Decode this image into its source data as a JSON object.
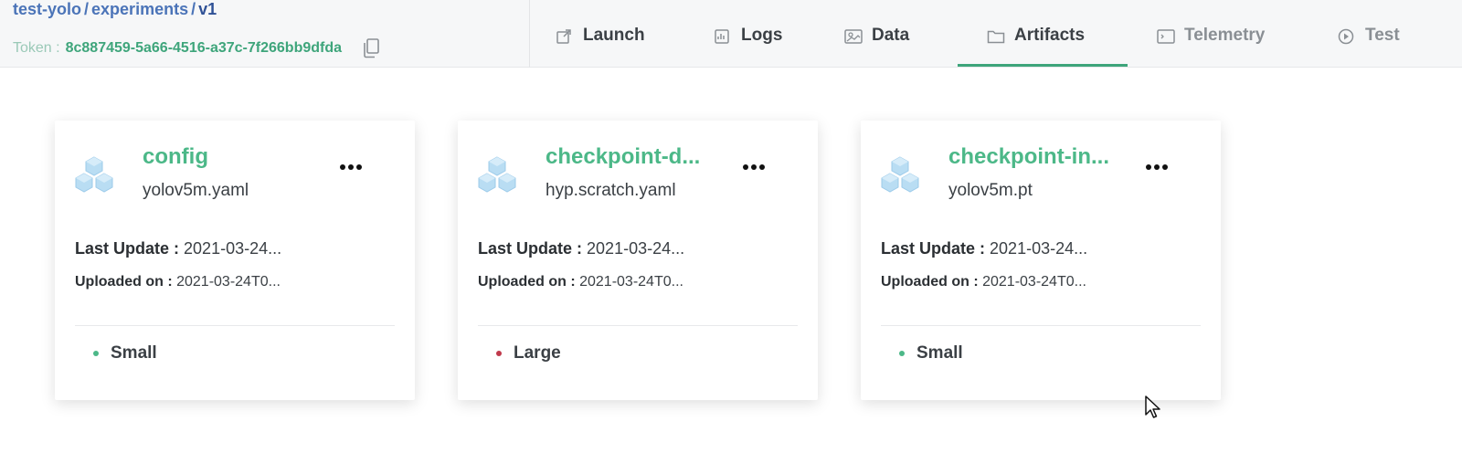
{
  "breadcrumb": {
    "project": "test-yolo",
    "section": "experiments",
    "current": "v1",
    "separator": "/"
  },
  "token": {
    "label": "Token :",
    "value": "8c887459-5a66-4516-a37c-7f266bb9dfda"
  },
  "tabs": [
    {
      "label": "Launch",
      "icon": "launch-icon",
      "state": "normal"
    },
    {
      "label": "Logs",
      "icon": "logs-icon",
      "state": "normal"
    },
    {
      "label": "Data",
      "icon": "data-icon",
      "state": "normal"
    },
    {
      "label": "Artifacts",
      "icon": "folder-icon",
      "state": "active"
    },
    {
      "label": "Telemetry",
      "icon": "terminal-icon",
      "state": "disabled"
    },
    {
      "label": "Test",
      "icon": "play-circle-icon",
      "state": "disabled"
    }
  ],
  "cards": [
    {
      "title": "config",
      "file": "yolov5m.yaml",
      "last_update_label": "Last Update :",
      "last_update": "2021-03-24...",
      "uploaded_label": "Uploaded on :",
      "uploaded": "2021-03-24T0...",
      "size": "Small",
      "size_color": "#4cb888"
    },
    {
      "title": "checkpoint-d...",
      "file": "hyp.scratch.yaml",
      "last_update_label": "Last Update :",
      "last_update": "2021-03-24...",
      "uploaded_label": "Uploaded on :",
      "uploaded": "2021-03-24T0...",
      "size": "Large",
      "size_color": "#c0394b"
    },
    {
      "title": "checkpoint-in...",
      "file": "yolov5m.pt",
      "last_update_label": "Last Update :",
      "last_update": "2021-03-24...",
      "uploaded_label": "Uploaded on :",
      "uploaded": "2021-03-24T0...",
      "size": "Small",
      "size_color": "#4cb888"
    }
  ],
  "colors": {
    "accent": "#3ea57b",
    "breadcrumb": "#4b74b8",
    "artifact_icon": "#a9d3ef"
  }
}
